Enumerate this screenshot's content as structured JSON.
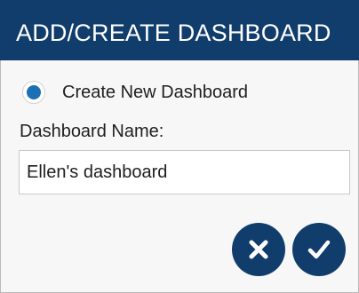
{
  "dialog": {
    "title": "ADD/CREATE DASHBOARD",
    "option": {
      "label": "Create New Dashboard",
      "selected": true
    },
    "name_field": {
      "label": "Dashboard Name:",
      "value": "Ellen's dashboard"
    },
    "actions": {
      "cancel_icon": "close-icon",
      "confirm_icon": "check-icon"
    }
  },
  "colors": {
    "header_bg": "#113d6c",
    "button_bg": "#113d6c",
    "radio_fill": "#1a6fb5",
    "panel_bg": "#f7f7f7"
  }
}
